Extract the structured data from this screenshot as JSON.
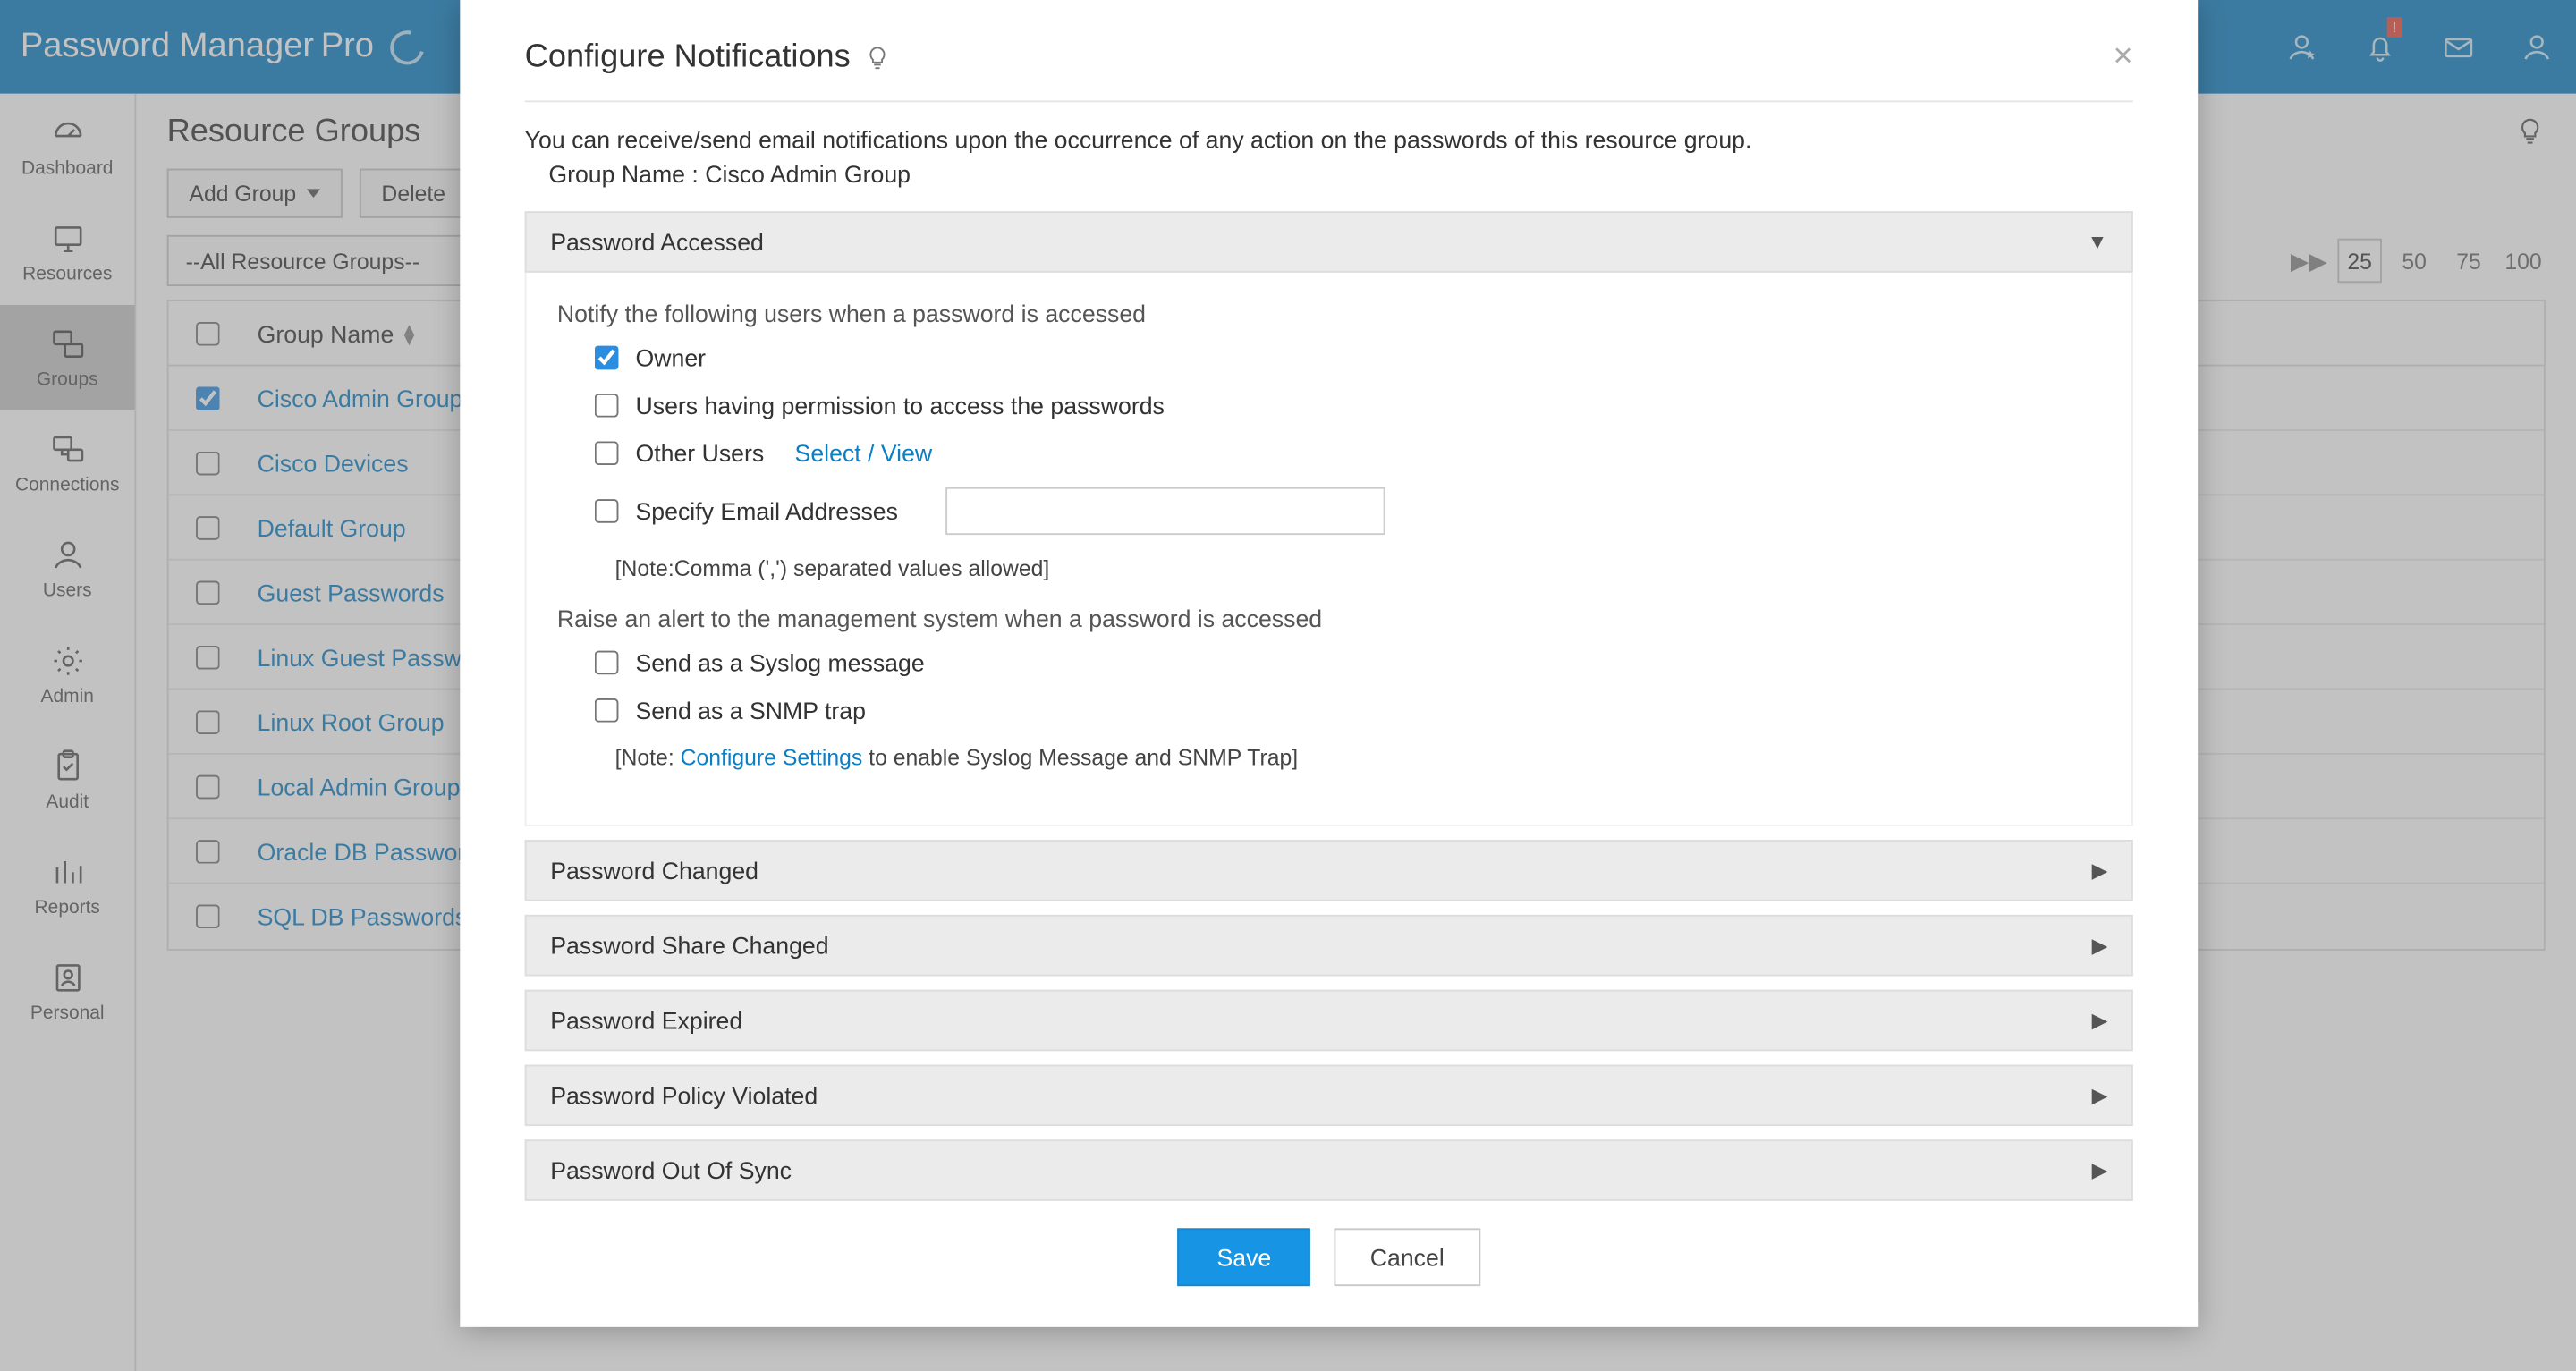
{
  "brand": {
    "name_a": "Password Manager",
    "name_b": "Pro"
  },
  "topbar_badge": "!",
  "sidebar": {
    "items": [
      {
        "label": "Dashboard"
      },
      {
        "label": "Resources"
      },
      {
        "label": "Groups"
      },
      {
        "label": "Connections"
      },
      {
        "label": "Users"
      },
      {
        "label": "Admin"
      },
      {
        "label": "Audit"
      },
      {
        "label": "Reports"
      },
      {
        "label": "Personal"
      }
    ]
  },
  "page": {
    "title": "Resource Groups",
    "add_group_label": "Add Group",
    "delete_label": "Delete",
    "filter_value": "--All Resource Groups--"
  },
  "pager": {
    "options": [
      "25",
      "50",
      "75",
      "100"
    ],
    "active_index": 0
  },
  "table": {
    "group_header": "Group Name",
    "rows": [
      {
        "name": "Cisco Admin Group",
        "checked": true
      },
      {
        "name": "Cisco Devices",
        "checked": false
      },
      {
        "name": "Default Group",
        "checked": false
      },
      {
        "name": "Guest Passwords",
        "checked": false
      },
      {
        "name": "Linux Guest Passwords",
        "checked": false
      },
      {
        "name": "Linux Root Group",
        "checked": false
      },
      {
        "name": "Local Admin Group",
        "checked": false
      },
      {
        "name": "Oracle DB Passwords",
        "checked": false
      },
      {
        "name": "SQL DB Passwords",
        "checked": false
      }
    ]
  },
  "modal": {
    "title": "Configure Notifications",
    "description": "You can receive/send email notifications upon the occurrence of any action on the passwords of this resource group.",
    "group_line_prefix": "Group Name : ",
    "group_name": "Cisco Admin Group",
    "accordion": {
      "open": {
        "header": "Password Accessed",
        "notify_label": "Notify the following users when a password is accessed",
        "owner": "Owner",
        "users_perm": "Users having permission to access the passwords",
        "other_users": "Other Users",
        "select_view": "Select / View",
        "specify_email": "Specify Email Addresses",
        "email_note": "[Note:Comma (',') separated values allowed]",
        "raise_label": "Raise an alert to the management system when a password is accessed",
        "syslog": "Send as a Syslog message",
        "snmp": "Send as a SNMP trap",
        "note_prefix": "[Note: ",
        "configure_settings": "Configure Settings",
        "note_suffix": " to enable Syslog Message and SNMP Trap]"
      },
      "closed": [
        "Password Changed",
        "Password Share Changed",
        "Password Expired",
        "Password Policy Violated",
        "Password Out Of Sync"
      ]
    },
    "save": "Save",
    "cancel": "Cancel"
  }
}
